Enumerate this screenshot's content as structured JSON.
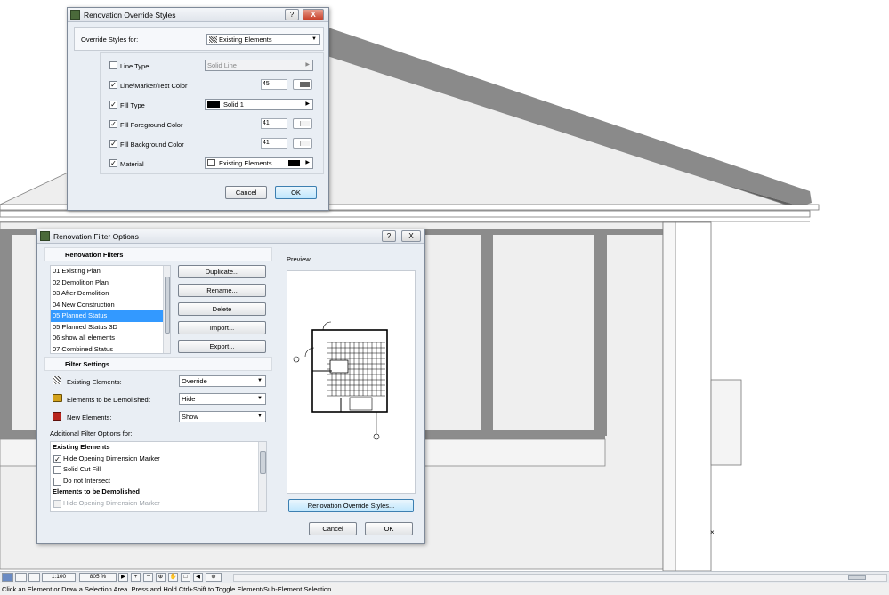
{
  "override_dialog": {
    "title": "Renovation Override Styles",
    "help_label": "?",
    "close_label": "X",
    "override_for_label": "Override Styles for:",
    "override_for_value": "Existing Elements",
    "rows": [
      {
        "label": "Line Type",
        "checked": false,
        "value": "Solid Line"
      },
      {
        "label": "Line/Marker/Text Color",
        "checked": true,
        "value": "45"
      },
      {
        "label": "Fill Type",
        "checked": true,
        "value": "Solid 1"
      },
      {
        "label": "Fill Foreground Color",
        "checked": true,
        "value": "41"
      },
      {
        "label": "Fill Background Color",
        "checked": true,
        "value": "41"
      },
      {
        "label": "Material",
        "checked": true,
        "value": "Existing Elements"
      }
    ],
    "cancel_label": "Cancel",
    "ok_label": "OK"
  },
  "filter_dialog": {
    "title": "Renovation Filter Options",
    "help_label": "?",
    "close_label": "X",
    "filters_header": "Renovation Filters",
    "filters": [
      "01 Existing Plan",
      "02 Demolition Plan",
      "03 After Demolition",
      "04 New Construction",
      "05 Planned Status",
      "05 Planned Status 3D",
      "06 show all elements",
      "07 Combined Status"
    ],
    "selected_filter_index": 4,
    "buttons": {
      "duplicate": "Duplicate...",
      "rename": "Rename...",
      "delete": "Delete",
      "import": "Import...",
      "export": "Export..."
    },
    "settings_header": "Filter Settings",
    "settings": [
      {
        "label": "Existing Elements:",
        "value": "Override",
        "icon": "existing-hatch-icon"
      },
      {
        "label": "Elements to be Demolished:",
        "value": "Hide",
        "icon": "demolish-bulldozer-icon"
      },
      {
        "label": "New Elements:",
        "value": "Show",
        "icon": "new-elements-icon"
      }
    ],
    "additional_label": "Additional Filter Options for:",
    "options": [
      {
        "type": "header",
        "label": "Existing Elements"
      },
      {
        "type": "option",
        "label": "Hide Opening Dimension Marker",
        "checked": true,
        "disabled": false
      },
      {
        "type": "option",
        "label": "Solid Cut Fill",
        "checked": false,
        "disabled": false
      },
      {
        "type": "option",
        "label": "Do not Intersect",
        "checked": false,
        "disabled": false
      },
      {
        "type": "header",
        "label": "Elements to be Demolished"
      },
      {
        "type": "option",
        "label": "Hide Opening Dimension Marker",
        "checked": false,
        "disabled": true
      }
    ],
    "preview_label": "Preview",
    "override_button": "Renovation Override Styles...",
    "cancel_label": "Cancel",
    "ok_label": "OK"
  },
  "toolbar": {
    "scale": "1:100",
    "zoom": "805 %"
  },
  "status_bar": {
    "text": "Click an Element or Draw a Selection Area. Press and Hold Ctrl+Shift to Toggle Element/Sub-Element Selection."
  },
  "colors": {
    "dialog_bg": "#e9eef4",
    "selection": "#3399ff",
    "roof": "#7a7a7a",
    "wall": "#8c8c8c",
    "drawing_fill": "#ececec"
  }
}
